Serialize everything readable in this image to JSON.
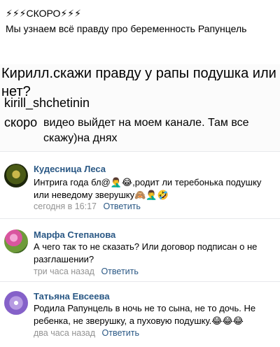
{
  "post": {
    "title": "⚡⚡⚡СКОРО⚡⚡⚡",
    "subtitle": "Мы узнаем всё правду про беременность Рапунцель"
  },
  "screenshot": {
    "question": "Кирилл.скажи правду у рапы  подушка или нет?",
    "username": "kirill_shchetinin",
    "answer_lead": "скоро",
    "answer_body": "видео выйдет на моем канале. Там все скажу)на днях"
  },
  "comments": [
    {
      "author": "Кудесница Леса",
      "text": "Интрига года бл@🤦‍♂️😂,родит ли теребонька подушку или неведому зверушку🙈🤦‍♂️🤣",
      "time": "сегодня в 16:17",
      "reply_label": "Ответить"
    },
    {
      "author": "Марфа Степанова",
      "text": "А чего так то не сказать? Или договор подписан о не разглашении?",
      "time": "три часа назад",
      "reply_label": "Ответить"
    },
    {
      "author": "Татьяна Евсеева",
      "text": "Родила Рапунцель в ночь не то сына, не то дочь. Не ребенка, не зверушку, а пуховую подушку.😂😂😂",
      "time": "два часа назад",
      "reply_label": "Ответить"
    }
  ],
  "colors": {
    "link": "#2a5885",
    "meta": "#939393",
    "divider": "#e7e8ec"
  }
}
